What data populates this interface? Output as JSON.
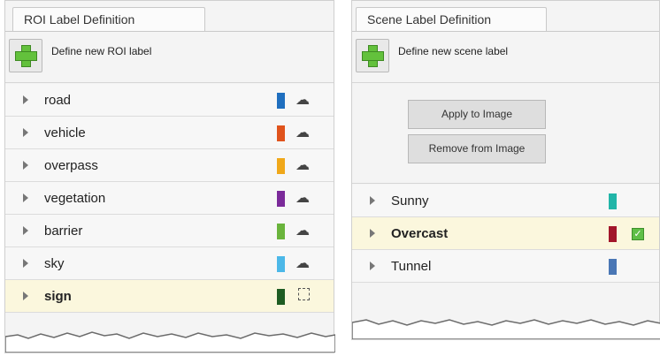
{
  "roi_panel": {
    "tab_label": "ROI Label Definition",
    "define_label": "Define new ROI label",
    "labels": [
      {
        "name": "road",
        "color": "#1f6fbf",
        "selected": false
      },
      {
        "name": "vehicle",
        "color": "#e0531c",
        "selected": false
      },
      {
        "name": "overpass",
        "color": "#f0a81a",
        "selected": false
      },
      {
        "name": "vegetation",
        "color": "#7b2a9a",
        "selected": false
      },
      {
        "name": "barrier",
        "color": "#6ab43c",
        "selected": false
      },
      {
        "name": "sky",
        "color": "#4cb8e8",
        "selected": false
      },
      {
        "name": "sign",
        "color": "#1e5c22",
        "selected": true
      }
    ]
  },
  "scene_panel": {
    "tab_label": "Scene Label Definition",
    "define_label": "Define new scene label",
    "apply_button": "Apply to Image",
    "remove_button": "Remove from Image",
    "labels": [
      {
        "name": "Sunny",
        "color": "#21b5a8",
        "selected": false,
        "checked": false
      },
      {
        "name": "Overcast",
        "color": "#a2162a",
        "selected": true,
        "checked": true
      },
      {
        "name": "Tunnel",
        "color": "#4a77b5",
        "selected": false,
        "checked": false
      }
    ]
  }
}
